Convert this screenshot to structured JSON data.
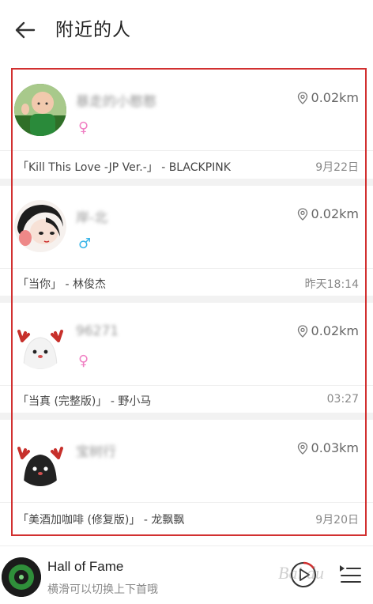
{
  "header": {
    "title": "附近的人"
  },
  "users": [
    {
      "name": "暴走的小憨憨",
      "distance": "0.02km",
      "gender": "♀",
      "song": "「Kill This Love -JP Ver.-」 - BLACKPINK",
      "date": "9月22日"
    },
    {
      "name": "岸-北",
      "distance": "0.02km",
      "gender": "♂",
      "song": "「当你」 - 林俊杰",
      "date": "昨天18:14"
    },
    {
      "name": "96271",
      "distance": "0.02km",
      "gender": "♀",
      "song": "「当真 (完整版)」 - 野小马",
      "date": "03:27"
    },
    {
      "name": "宝树行",
      "distance": "0.03km",
      "gender": "",
      "song": "「美酒加咖啡 (修复版)」 - 龙飘飘",
      "date": "9月20日"
    }
  ],
  "player": {
    "title": "Hall of Fame",
    "subtitle": "横滑可以切换上下首哦"
  },
  "watermark": "Bai du",
  "colors": {
    "female": "#f07fc3",
    "male": "#3ab5e8",
    "highlight": "#d23030"
  }
}
